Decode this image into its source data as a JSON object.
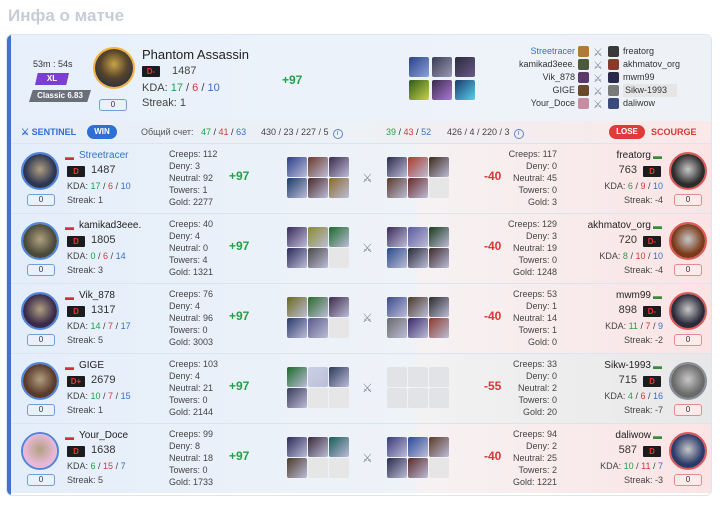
{
  "page_title": "Инфа о матче",
  "header": {
    "time": "53m : 54s",
    "badge1": "XL",
    "badge2": "Classic 6.83",
    "level": "0",
    "player": {
      "hero": "Phantom Assassin",
      "rank": "D-",
      "rating": "1487",
      "kda_label": "KDA:",
      "k": "17",
      "d": "6",
      "a": "10",
      "streak": "Streak: 1",
      "delta": "+97"
    },
    "sentinel_list": [
      "Streetracer",
      "kamikad3eee.",
      "Vik_878",
      "GIGE",
      "Your_Doce"
    ],
    "scourge_list": [
      "freatorg",
      "akhmatov_org",
      "mwm99",
      "Sikw-1993",
      "daliwow"
    ]
  },
  "teambar": {
    "sentinel": "SENTINEL",
    "win": "WIN",
    "score_label": "Общий счет:",
    "s_k": "47",
    "s_d": "41",
    "s_a": "63",
    "s_stats": "430 / 23 / 227 / 5",
    "c_k": "39",
    "c_d": "43",
    "c_a": "52",
    "c_stats": "426 / 4 / 220 / 3",
    "lose": "LOSE",
    "scourge": "SCOURGE"
  },
  "rows": [
    {
      "l": {
        "name": "Streetracer",
        "rank": "D",
        "rating": "1487",
        "k": "17",
        "d": "6",
        "a": "10",
        "streak": "Streak: 1",
        "level": "0",
        "creeps": "Creeps: 112",
        "deny": "Deny: 3",
        "neutral": "Neutral: 92",
        "towers": "Towers: 1",
        "gold": "Gold: 2277",
        "delta": "+97"
      },
      "r": {
        "name": "freatorg",
        "rank": "D",
        "rating": "763",
        "k": "6",
        "d": "9",
        "a": "10",
        "streak": "Streak: -4",
        "level": "0",
        "creeps": "Creeps: 117",
        "deny": "Deny: 0",
        "neutral": "Neutral: 45",
        "towers": "Towers: 0",
        "gold": "Gold: 3",
        "delta": "-40"
      }
    },
    {
      "l": {
        "name": "kamikad3eee.",
        "rank": "D",
        "rating": "1805",
        "k": "0",
        "d": "6",
        "a": "14",
        "streak": "Streak: 3",
        "level": "0",
        "creeps": "Creeps: 40",
        "deny": "Deny: 4",
        "neutral": "Neutral: 0",
        "towers": "Towers: 4",
        "gold": "Gold: 1321",
        "delta": "+97"
      },
      "r": {
        "name": "akhmatov_org",
        "rank": "D-",
        "rating": "720",
        "k": "8",
        "d": "10",
        "a": "10",
        "streak": "Streak: -4",
        "level": "0",
        "creeps": "Creeps: 129",
        "deny": "Deny: 3",
        "neutral": "Neutral: 19",
        "towers": "Towers: 0",
        "gold": "Gold: 1248",
        "delta": "-40"
      }
    },
    {
      "l": {
        "name": "Vik_878",
        "rank": "D",
        "rating": "1317",
        "k": "14",
        "d": "7",
        "a": "17",
        "streak": "Streak: 5",
        "level": "0",
        "creeps": "Creeps: 76",
        "deny": "Deny: 4",
        "neutral": "Neutral: 96",
        "towers": "Towers: 0",
        "gold": "Gold: 3003",
        "delta": "+97"
      },
      "r": {
        "name": "mwm99",
        "rank": "D-",
        "rating": "898",
        "k": "11",
        "d": "7",
        "a": "9",
        "streak": "Streak: -2",
        "level": "0",
        "creeps": "Creeps: 53",
        "deny": "Deny: 1",
        "neutral": "Neutral: 14",
        "towers": "Towers: 1",
        "gold": "Gold: 0",
        "delta": "-40"
      }
    },
    {
      "l": {
        "name": "GIGE",
        "rank": "D+",
        "rating": "2679",
        "k": "10",
        "d": "7",
        "a": "15",
        "streak": "Streak: 1",
        "level": "0",
        "creeps": "Creeps: 103",
        "deny": "Deny: 4",
        "neutral": "Neutral: 21",
        "towers": "Towers: 0",
        "gold": "Gold: 2144",
        "delta": "+97"
      },
      "r": {
        "name": "Sikw-1993",
        "rank": "D",
        "rating": "715",
        "k": "4",
        "d": "6",
        "a": "16",
        "streak": "Streak: -7",
        "level": "0",
        "creeps": "Creeps: 33",
        "deny": "Deny: 0",
        "neutral": "Neutral: 2",
        "towers": "Towers: 0",
        "gold": "Gold: 20",
        "delta": "-55"
      }
    },
    {
      "l": {
        "name": "Your_Doce",
        "rank": "D",
        "rating": "1638",
        "k": "6",
        "d": "15",
        "a": "7",
        "streak": "Streak: 5",
        "level": "0",
        "creeps": "Creeps: 99",
        "deny": "Deny: 8",
        "neutral": "Neutral: 18",
        "towers": "Towers: 0",
        "gold": "Gold: 1733",
        "delta": "+97"
      },
      "r": {
        "name": "daliwow",
        "rank": "D",
        "rating": "587",
        "k": "10",
        "d": "11",
        "a": "7",
        "streak": "Streak: -3",
        "level": "0",
        "creeps": "Creeps: 94",
        "deny": "Deny: 2",
        "neutral": "Neutral: 25",
        "towers": "Towers: 2",
        "gold": "Gold: 1221",
        "delta": "-40"
      }
    }
  ],
  "colors": {
    "win_blue": "#2f6fd4",
    "lose_red": "#e03a3a",
    "kill_green": "#23a046",
    "death_red": "#d93636",
    "assist_blue": "#3570c4"
  }
}
